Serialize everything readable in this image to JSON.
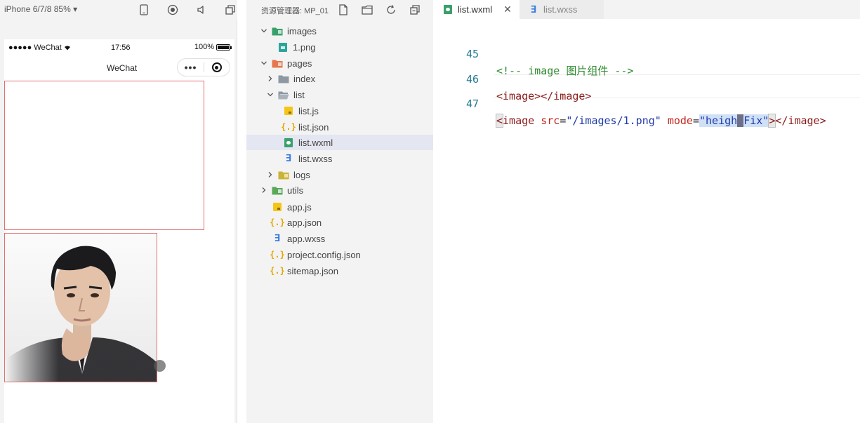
{
  "simulator": {
    "device_label": "iPhone 6/7/8 85% ▾",
    "status": {
      "carrier": "●●●●● WeChat",
      "time": "17:56",
      "battery": "100%"
    },
    "nav_title": "WeChat",
    "capsule_more": "•••"
  },
  "explorer": {
    "title": "资源管理器: MP_01",
    "tree": [
      {
        "label": "images",
        "kind": "folder-green",
        "open": true
      },
      {
        "label": "1.png",
        "kind": "png"
      },
      {
        "label": "pages",
        "kind": "folder-orange",
        "open": true
      },
      {
        "label": "index",
        "kind": "folder-gray",
        "open": false
      },
      {
        "label": "list",
        "kind": "folder-gray",
        "open": true
      },
      {
        "label": "list.js",
        "kind": "js"
      },
      {
        "label": "list.json",
        "kind": "json"
      },
      {
        "label": "list.wxml",
        "kind": "wxml",
        "selected": true
      },
      {
        "label": "list.wxss",
        "kind": "wxss"
      },
      {
        "label": "logs",
        "kind": "folder-gray",
        "open": false
      },
      {
        "label": "utils",
        "kind": "folder-green",
        "open": false
      },
      {
        "label": "app.js",
        "kind": "js"
      },
      {
        "label": "app.json",
        "kind": "json"
      },
      {
        "label": "app.wxss",
        "kind": "wxss"
      },
      {
        "label": "project.config.json",
        "kind": "json"
      },
      {
        "label": "sitemap.json",
        "kind": "json"
      }
    ]
  },
  "editor": {
    "tabs": [
      {
        "label": "list.wxml",
        "active": true,
        "close": "✕"
      },
      {
        "label": "list.wxss",
        "active": false
      }
    ],
    "lines": [
      {
        "number": "45",
        "comment": "<!-- image 图片组件 -->"
      },
      {
        "number": "46",
        "open_tag": "<image>",
        "close_tag": "</image>"
      },
      {
        "number": "47",
        "lt": "<",
        "tag_name": "image",
        "src_attr": "src",
        "eq1": "=",
        "src_value": "\"/images/1.png\"",
        "mode_attr": "mode",
        "eq2": "=",
        "mode_value_part1": "\"heigh",
        "mode_value_caret": "t",
        "mode_value_part2": "Fix\"",
        "gt": ">",
        "close_tag": "</image>"
      }
    ]
  },
  "colors": {
    "comment": "#2f8a2f",
    "tag": "#8b1a1a",
    "attribute": "#c2261d",
    "string": "#1f3aa8",
    "line_number": "#237893",
    "image_border": "#e07070",
    "selection": "#cfe0f7"
  },
  "icons": [
    "phone-icon",
    "record-icon",
    "sound-icon",
    "window-icon",
    "new-file-icon",
    "new-folder-icon",
    "refresh-icon",
    "collapse-icon",
    "wifi-icon",
    "battery-icon",
    "more-icon",
    "close-capsule-icon"
  ]
}
